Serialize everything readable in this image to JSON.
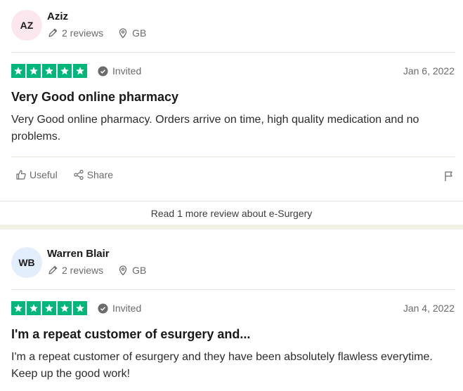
{
  "colors": {
    "star_green": "#00b67a",
    "avatar_pink": "#fde7ee",
    "avatar_blue": "#e3eefc"
  },
  "reviews": [
    {
      "initials": "AZ",
      "name": "Aziz",
      "reviews_count": "2 reviews",
      "country": "GB",
      "rating": 5,
      "invited_label": "Invited",
      "date": "Jan 6, 2022",
      "title": "Very Good online pharmacy",
      "body": "Very Good online pharmacy. Orders arrive on time, high quality medication and no problems.",
      "useful_label": "Useful",
      "share_label": "Share"
    },
    {
      "initials": "WB",
      "name": "Warren Blair",
      "reviews_count": "2 reviews",
      "country": "GB",
      "rating": 5,
      "invited_label": "Invited",
      "date": "Jan 4, 2022",
      "title": "I'm a repeat customer of esurgery and...",
      "body": "I'm a repeat customer of esurgery and they have been absolutely flawless everytime. Keep up the good work!"
    }
  ],
  "read_more": "Read 1 more review about e-Surgery"
}
